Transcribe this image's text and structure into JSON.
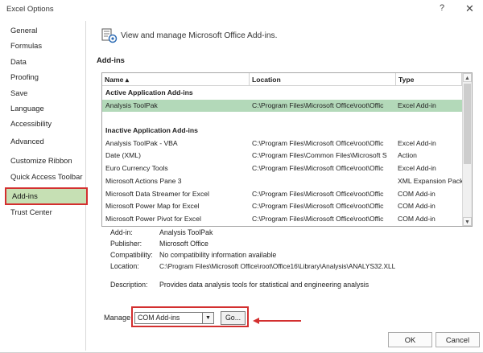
{
  "window": {
    "title": "Excel Options",
    "help": "?",
    "close": "✕"
  },
  "sidebar": {
    "items": [
      {
        "label": "General"
      },
      {
        "label": "Formulas"
      },
      {
        "label": "Data"
      },
      {
        "label": "Proofing"
      },
      {
        "label": "Save"
      },
      {
        "label": "Language"
      },
      {
        "label": "Accessibility"
      },
      {
        "label": "Advanced"
      },
      {
        "label": "Customize Ribbon"
      },
      {
        "label": "Quick Access Toolbar"
      },
      {
        "label": "Add-ins",
        "selected": true
      },
      {
        "label": "Trust Center"
      }
    ]
  },
  "main": {
    "heading": "View and manage Microsoft Office Add-ins.",
    "section_label": "Add-ins",
    "table": {
      "headers": {
        "name": "Name ▴",
        "location": "Location",
        "type": "Type"
      },
      "rows": [
        {
          "group": "Active Application Add-ins"
        },
        {
          "name": "Analysis ToolPak",
          "location": "C:\\Program Files\\Microsoft Office\\root\\Offic",
          "type": "Excel Add-in",
          "selected": true
        },
        {
          "blank": true
        },
        {
          "group": "Inactive Application Add-ins"
        },
        {
          "name": "Analysis ToolPak - VBA",
          "location": "C:\\Program Files\\Microsoft Office\\root\\Offic",
          "type": "Excel Add-in"
        },
        {
          "name": "Date (XML)",
          "location": "C:\\Program Files\\Common Files\\Microsoft S",
          "type": "Action"
        },
        {
          "name": "Euro Currency Tools",
          "location": "C:\\Program Files\\Microsoft Office\\root\\Offic",
          "type": "Excel Add-in"
        },
        {
          "name": "Microsoft Actions Pane 3",
          "location": "",
          "type": "XML Expansion Pack"
        },
        {
          "name": "Microsoft Data Streamer for Excel",
          "location": "C:\\Program Files\\Microsoft Office\\root\\Offic",
          "type": "COM Add-in"
        },
        {
          "name": "Microsoft Power Map for Excel",
          "location": "C:\\Program Files\\Microsoft Office\\root\\Offic",
          "type": "COM Add-in"
        },
        {
          "name": "Microsoft Power Pivot for Excel",
          "location": "C:\\Program Files\\Microsoft Office\\root\\Offic",
          "type": "COM Add-in"
        }
      ]
    },
    "details": {
      "addin": {
        "label": "Add-in:",
        "value": "Analysis ToolPak"
      },
      "publisher": {
        "label": "Publisher:",
        "value": "Microsoft Office"
      },
      "compatibility": {
        "label": "Compatibility:",
        "value": "No compatibility information available"
      },
      "location": {
        "label": "Location:",
        "value": "C:\\Program Files\\Microsoft Office\\root\\Office16\\Library\\Analysis\\ANALYS32.XLL"
      },
      "description": {
        "label": "Description:",
        "value": "Provides data analysis tools for statistical and engineering analysis"
      }
    },
    "manage": {
      "label": "Manage:",
      "selected": "COM Add-ins",
      "go_label": "Go..."
    }
  },
  "footer": {
    "ok": "OK",
    "cancel": "Cancel"
  },
  "colors": {
    "selection_green": "#c6e0b4",
    "highlight_red": "#d32f2f"
  },
  "icons": {
    "header": "addins-gear-icon",
    "dropdown": "chevron-down-icon",
    "arrow": "red-arrow-icon"
  }
}
